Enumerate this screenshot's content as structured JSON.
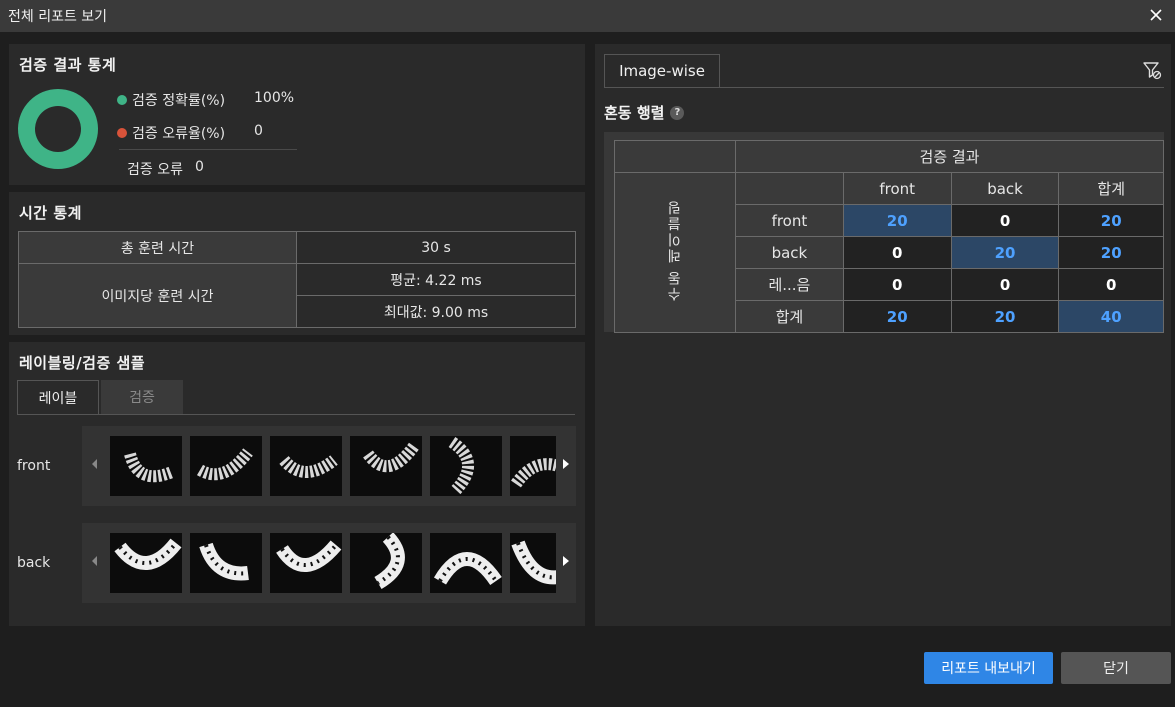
{
  "window": {
    "title": "전체 리포트 보기",
    "close_icon": "close-icon"
  },
  "validation_stats": {
    "title": "검증 결과 통계",
    "accuracy_label": "검증 정확률(%)",
    "accuracy_value": "100%",
    "accuracy_color": "#3fb487",
    "error_rate_label": "검증 오류율(%)",
    "error_rate_value": "0",
    "error_rate_color": "#d9533a",
    "error_count_label": "검증 오류",
    "error_count_value": "0"
  },
  "time_stats": {
    "title": "시간 통계",
    "total_label": "총 훈련 시간",
    "total_value": "30 s",
    "per_image_label": "이미지당 훈련 시간",
    "avg_value": "평균: 4.22 ms",
    "max_value": "최대값: 9.00 ms"
  },
  "samples": {
    "title": "레이블링/검증 샘플",
    "tabs": [
      "레이블",
      "검증"
    ],
    "active_tab": "레이블",
    "rows": [
      {
        "label": "front"
      },
      {
        "label": "back"
      }
    ]
  },
  "right_panel": {
    "tab_label": "Image-wise",
    "filter_icon": "filter-icon",
    "confusion_title": "혼동 행렬",
    "help_icon_text": "?",
    "matrix": {
      "top_header": "검증 결과",
      "side_header": "수동 레이블링",
      "columns": [
        "front",
        "back",
        "합계"
      ],
      "rows": [
        {
          "label": "front",
          "values": [
            "20",
            "0",
            "20"
          ]
        },
        {
          "label": "back",
          "values": [
            "0",
            "20",
            "20"
          ]
        },
        {
          "label": "레...음",
          "values": [
            "0",
            "0",
            "0"
          ]
        },
        {
          "label": "합계",
          "values": [
            "20",
            "20",
            "40"
          ]
        }
      ]
    }
  },
  "buttons": {
    "export": "리포트 내보내기",
    "close": "닫기"
  }
}
